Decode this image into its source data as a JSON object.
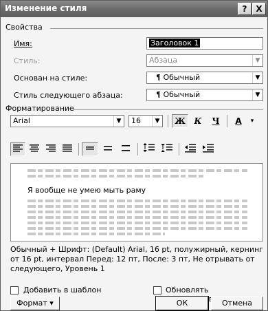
{
  "window": {
    "title": "Изменение стиля",
    "help_label": "?",
    "close_label": "X"
  },
  "properties": {
    "group_label": "Свойства",
    "name_label": "Имя:",
    "name_value": "Заголовок 1",
    "type_label": "Стиль:",
    "type_value": "Абзаца",
    "based_on_label": "Основан на стиле:",
    "based_on_value": "¶ Обычный",
    "next_label": "Стиль следующего абзаца:",
    "next_value": "¶ Обычный"
  },
  "formatting": {
    "group_label": "Форматирование",
    "font": "Arial",
    "size": "16",
    "bold_label": "Ж",
    "italic_label": "К",
    "underline_label": "Ч",
    "color_label": "А"
  },
  "preview": {
    "sample_text": "Я вообще не умею мыть раму"
  },
  "description": "Обычный + Шрифт: (Default) Arial, 16 pt, полужирный, кернинг от 16 pt, интервал Перед:  12 пт, После:  3 пт, Не отрывать от следующего, Уровень 1",
  "options": {
    "add_template_label": "Добавить в шаблон",
    "auto_update_label": "Обновлять автоматически"
  },
  "buttons": {
    "format_label": "Формат ▾",
    "ok_label": "ОК",
    "cancel_label": "Отмена"
  }
}
